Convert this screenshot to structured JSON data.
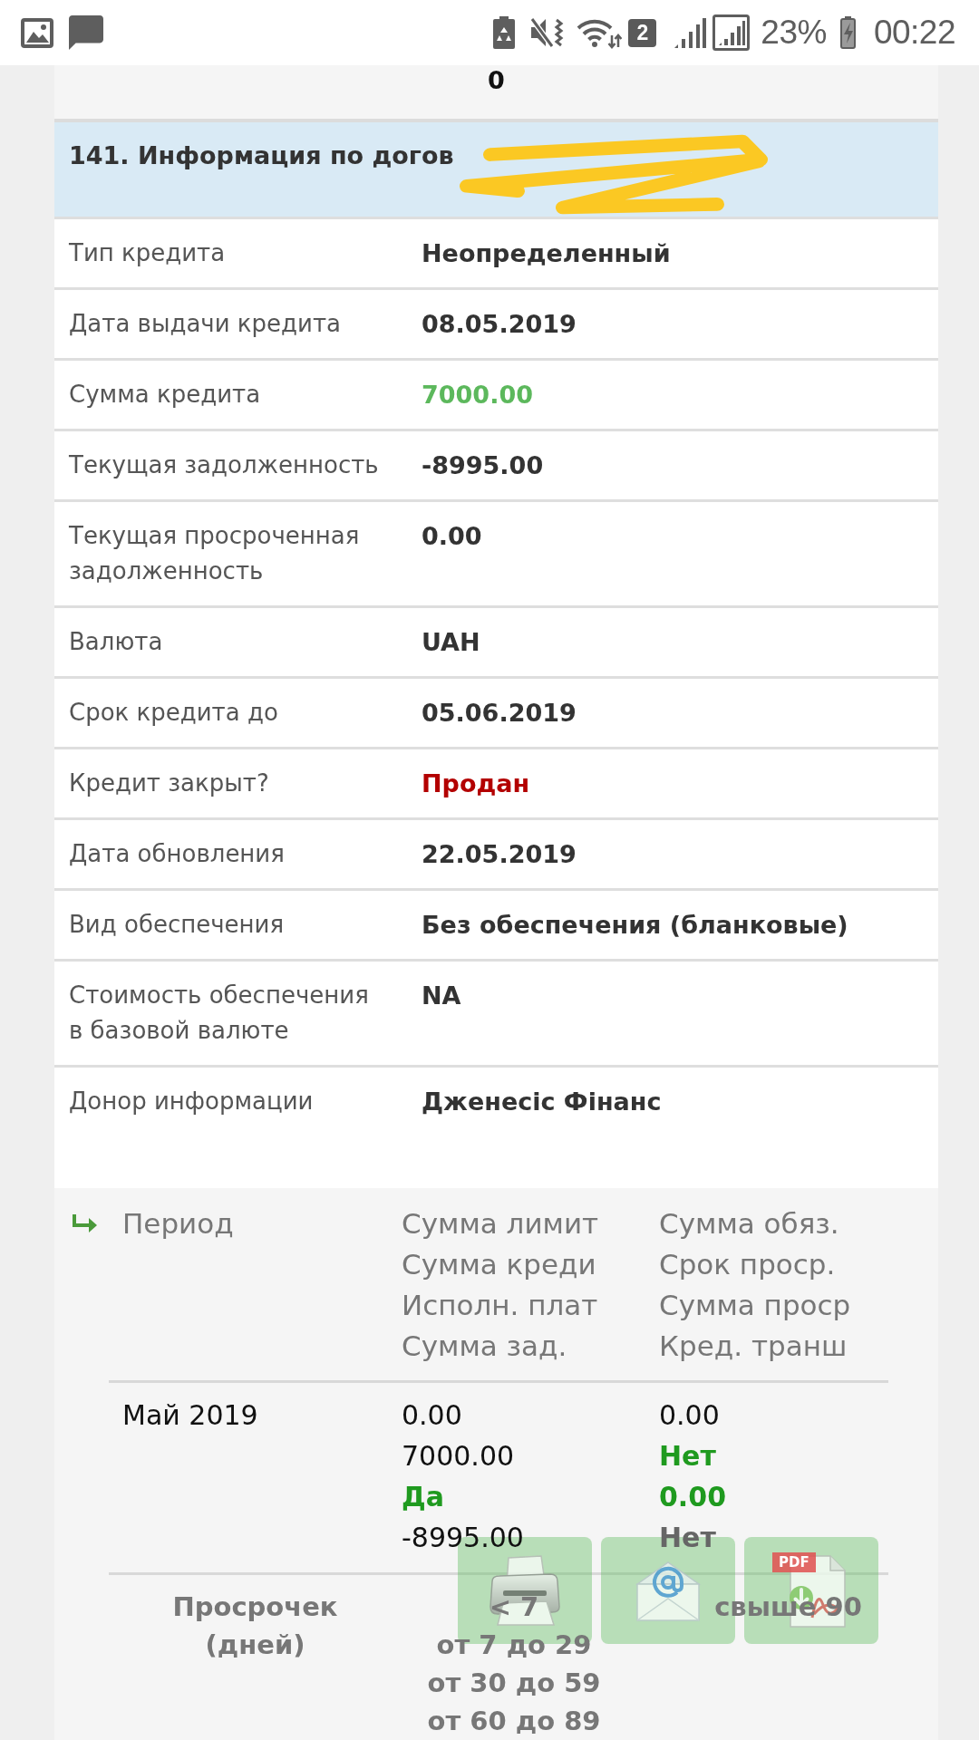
{
  "status_bar": {
    "sim_indicator": "2",
    "battery": "23%",
    "time": "00:22"
  },
  "previous_section": {
    "value": "0"
  },
  "contract_info": {
    "title": "141. Информация по догов",
    "redacted": true,
    "rows": [
      {
        "label": "Тип кредита",
        "value": "Неопределенный",
        "color": "#333333"
      },
      {
        "label": "Дата выдачи кредита",
        "value": "08.05.2019",
        "color": "#333333"
      },
      {
        "label": "Сумма кредита",
        "value": "7000.00",
        "color": "#5cb85c"
      },
      {
        "label": "Текущая задолженность",
        "value": "-8995.00",
        "color": "#333333"
      },
      {
        "label": "Текущая просроченная задолженность",
        "value": "0.00",
        "color": "#333333"
      },
      {
        "label": "Валюта",
        "value": "UAH",
        "color": "#333333"
      },
      {
        "label": "Срок кредита до",
        "value": "05.06.2019",
        "color": "#333333"
      },
      {
        "label": "Кредит закрыт?",
        "value": "Продан",
        "color": "#b30000"
      },
      {
        "label": "Дата обновления",
        "value": "22.05.2019",
        "color": "#333333"
      },
      {
        "label": "Вид обеспечения",
        "value": "Без обеспечения (бланковые)",
        "color": "#333333"
      },
      {
        "label": "Стоимость обеспечения в базовой валюте",
        "value": "NA",
        "color": "#333333"
      },
      {
        "label": "Донор информации",
        "value": "Дженесіс Фінанс",
        "color": "#333333"
      }
    ]
  },
  "payment_history": {
    "header": {
      "period": "Период",
      "column_2": [
        "Сумма лимит",
        "Сумма креди",
        "Исполн. плат",
        "Сумма зад."
      ],
      "column_3": [
        "Сумма обяз.",
        "Срок проср.",
        "Сумма проср",
        "Кред. транш"
      ]
    },
    "rows": [
      {
        "period": "Май 2019",
        "column_2": [
          {
            "text": "0.00",
            "kind": "plain",
            "color": "#111111"
          },
          {
            "text": "7000.00",
            "kind": "plain",
            "color": "#111111"
          },
          {
            "text": "Да",
            "kind": "strong",
            "color": "#1f9a1f"
          },
          {
            "text": "-8995.00",
            "kind": "plain",
            "color": "#111111"
          }
        ],
        "column_3": [
          {
            "text": "0.00",
            "kind": "plain",
            "color": "#111111"
          },
          {
            "text": "Нет",
            "kind": "strong",
            "color": "#1f9a1f"
          },
          {
            "text": "0.00",
            "kind": "strong",
            "color": "#1f9a1f"
          },
          {
            "text": "Нет",
            "kind": "strong",
            "color": "#666666"
          }
        ]
      }
    ]
  },
  "overdue": {
    "label": "Просрочек (дней)",
    "column_2": [
      "< 7",
      "от 7 до 29",
      "от 30 до 59",
      "от 60 до 89"
    ],
    "column_3": [
      "свыше 90"
    ]
  },
  "action_buttons": [
    {
      "kind": "print"
    },
    {
      "kind": "email"
    },
    {
      "kind": "pdf",
      "label": "PDF"
    }
  ]
}
